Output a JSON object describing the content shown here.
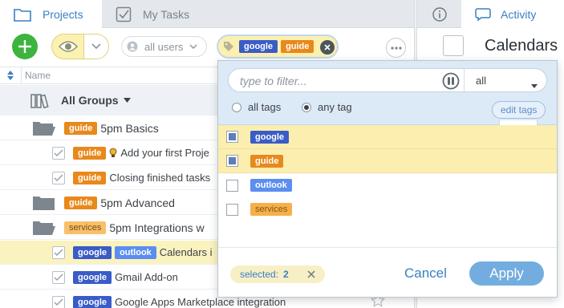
{
  "tabs": {
    "projects": "Projects",
    "mytasks": "My Tasks"
  },
  "right_tabs": {
    "activity": "Activity"
  },
  "toolbar": {
    "users_label": "all users"
  },
  "active_filter_tags": [
    "google",
    "guide"
  ],
  "list": {
    "column_name": "Name",
    "groups_label": "All Groups",
    "rows": [
      {
        "kind": "project",
        "tag": "guide",
        "title": "5pm Basics"
      },
      {
        "kind": "task",
        "tag": "guide",
        "title": "Add your first Proje"
      },
      {
        "kind": "task",
        "tag": "guide",
        "title": "Closing finished tasks"
      },
      {
        "kind": "project",
        "tag": "guide",
        "title": "5pm Advanced"
      },
      {
        "kind": "project",
        "tag": "services",
        "title": "5pm Integrations w"
      },
      {
        "kind": "task",
        "tags": [
          "google",
          "outlook"
        ],
        "title": "Calendars i"
      },
      {
        "kind": "task",
        "tag": "google",
        "title": "Gmail Add-on"
      },
      {
        "kind": "task",
        "tag": "google",
        "title": "Google Apps Marketplace integration"
      }
    ]
  },
  "right_panel": {
    "title": "Calendars"
  },
  "popup": {
    "filter_placeholder": "type to filter...",
    "mode_select": "all",
    "radio_all": "all tags",
    "radio_any": "any tag",
    "edit_tags": "edit tags",
    "tags": [
      {
        "name": "google",
        "checked": true
      },
      {
        "name": "guide",
        "checked": true
      },
      {
        "name": "outlook",
        "checked": false
      },
      {
        "name": "services",
        "checked": false
      }
    ],
    "selected_label": "selected:",
    "selected_count": "2",
    "cancel": "Cancel",
    "apply": "Apply"
  },
  "colors": {
    "accent": "#3a7fc1",
    "highlight": "#fbeeae",
    "add": "#3db43d"
  }
}
